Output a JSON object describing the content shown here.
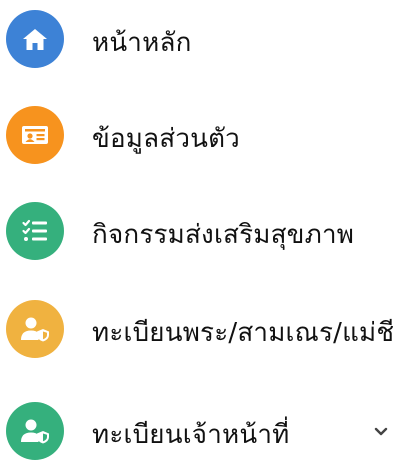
{
  "menu": {
    "items": [
      {
        "label": "หน้าหลัก",
        "icon": "home-icon",
        "color": "#3d82d6"
      },
      {
        "label": "ข้อมูลส่วนตัว",
        "icon": "id-card-icon",
        "color": "#f7931e"
      },
      {
        "label": "กิจกรรมส่งเสริมสุขภาพ",
        "icon": "checklist-icon",
        "color": "#35b07d"
      },
      {
        "label": "ทะเบียนพระ/สามเณร/แม่ชี",
        "icon": "user-shield-icon",
        "color": "#f0b240"
      },
      {
        "label": "ทะเบียนเจ้าหน้าที่",
        "icon": "user-shield-icon",
        "color": "#35b07d"
      }
    ],
    "expand_icon": "chevron-down-icon"
  }
}
